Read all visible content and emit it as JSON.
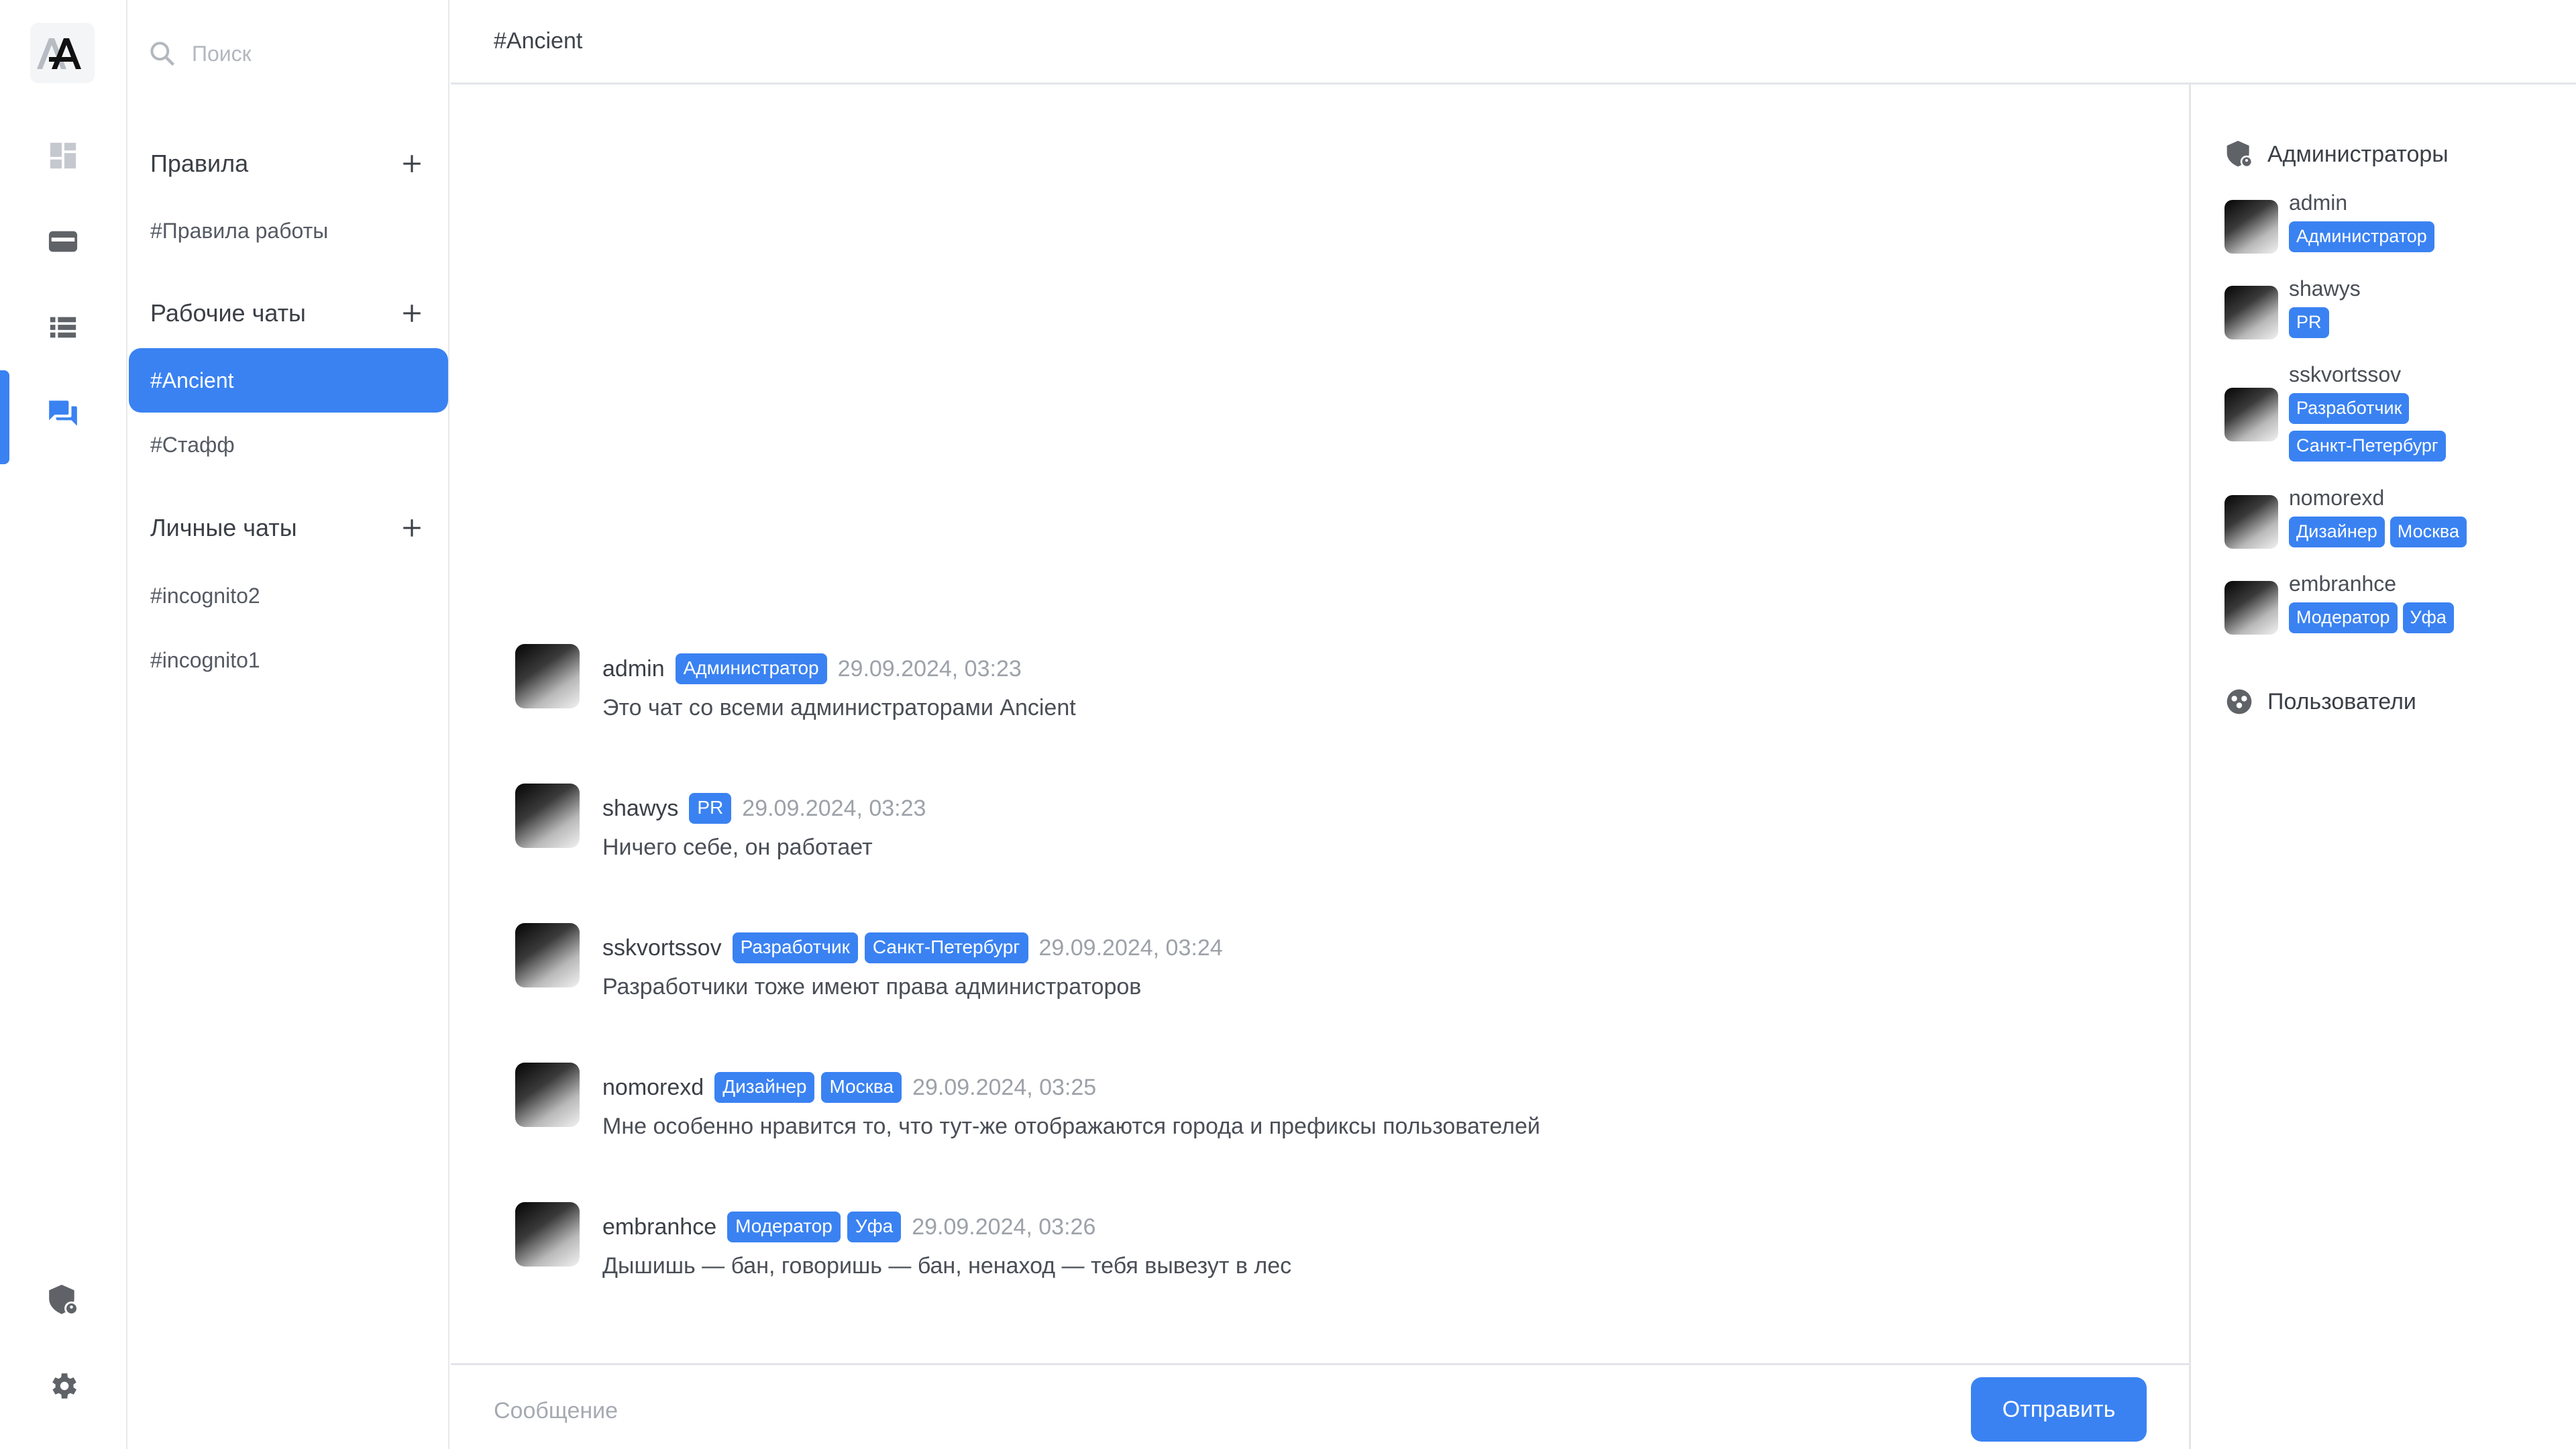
{
  "colors": {
    "accent": "#3a82f2",
    "icon_gray": "#c5c9cf",
    "icon_dark": "#5f6368"
  },
  "search": {
    "placeholder": "Поиск"
  },
  "sidebar": {
    "sections": [
      {
        "title": "Правила",
        "channels": [
          "#Правила работы"
        ]
      },
      {
        "title": "Рабочие чаты",
        "channels": [
          "#Ancient",
          "#Стафф"
        ]
      },
      {
        "title": "Личные чаты",
        "channels": [
          "#incognito2",
          "#incognito1"
        ]
      }
    ],
    "active_channel": "#Ancient"
  },
  "chat": {
    "title": "#Ancient",
    "messages": [
      {
        "user": "admin",
        "badges": [
          "Администратор"
        ],
        "time": "29.09.2024, 03:23",
        "text": "Это чат со всеми администраторами Ancient"
      },
      {
        "user": "shawys",
        "badges": [
          "PR"
        ],
        "time": "29.09.2024, 03:23",
        "text": "Ничего себе, он работает"
      },
      {
        "user": "sskvortssov",
        "badges": [
          "Разработчик",
          "Санкт-Петербург"
        ],
        "time": "29.09.2024, 03:24",
        "text": "Разработчики тоже имеют права администраторов"
      },
      {
        "user": "nomorexd",
        "badges": [
          "Дизайнер",
          "Москва"
        ],
        "time": "29.09.2024, 03:25",
        "text": "Мне особенно нравится то, что тут-же отображаются города и префиксы пользователей"
      },
      {
        "user": "embranhce",
        "badges": [
          "Модератор",
          "Уфа"
        ],
        "time": "29.09.2024, 03:26",
        "text": "Дышишь — бан, говоришь — бан, ненаход — тебя вывезут в лес"
      }
    ]
  },
  "composer": {
    "placeholder": "Сообщение",
    "send_label": "Отправить"
  },
  "members": {
    "admins_title": "Администраторы",
    "users_title": "Пользователи",
    "admins": [
      {
        "name": "admin",
        "badges": [
          "Администратор"
        ]
      },
      {
        "name": "shawys",
        "badges": [
          "PR"
        ]
      },
      {
        "name": "sskvortssov",
        "badges": [
          "Разработчик",
          "Санкт-Петербург"
        ]
      },
      {
        "name": "nomorexd",
        "badges": [
          "Дизайнер",
          "Москва"
        ]
      },
      {
        "name": "embranhce",
        "badges": [
          "Модератор",
          "Уфа"
        ]
      }
    ]
  }
}
